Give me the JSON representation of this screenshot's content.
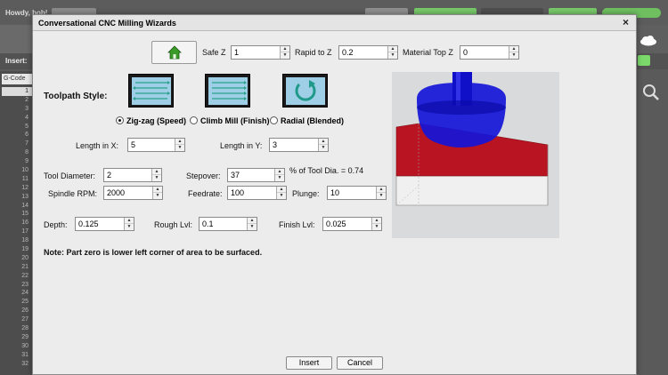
{
  "background": {
    "howdy": "Howdy, bob!",
    "insert_label": "Insert:",
    "gcode_tab": "G-Code",
    "line_numbers": [
      "1",
      "2",
      "3",
      "4",
      "5",
      "6",
      "7",
      "8",
      "9",
      "10",
      "11",
      "12",
      "13",
      "14",
      "15",
      "16",
      "17",
      "18",
      "19",
      "20",
      "21",
      "22",
      "23",
      "24",
      "25",
      "26",
      "27",
      "28",
      "29",
      "30",
      "31",
      "32"
    ]
  },
  "dialog": {
    "title": "Conversational CNC Milling Wizards",
    "close": "×",
    "top_row": {
      "safe_z_label": "Safe Z",
      "safe_z_value": "1",
      "rapid_to_z_label": "Rapid to Z",
      "rapid_to_z_value": "0.2",
      "material_top_z_label": "Material Top Z",
      "material_top_z_value": "0"
    },
    "toolpath_style_label": "Toolpath Style:",
    "toolpath_options": [
      {
        "label": "Zig-zag (Speed)",
        "selected": true
      },
      {
        "label": "Climb Mill (Finish)",
        "selected": false
      },
      {
        "label": "Radial (Blended)",
        "selected": false
      }
    ],
    "length_x_label": "Length in X:",
    "length_x_value": "5",
    "length_y_label": "Length in Y:",
    "length_y_value": "3",
    "tool_diameter_label": "Tool Diameter:",
    "tool_diameter_value": "2",
    "stepover_label": "Stepover:",
    "stepover_value": "37",
    "stepover_note": "% of Tool Dia. = 0.74",
    "spindle_rpm_label": "Spindle RPM:",
    "spindle_rpm_value": "2000",
    "feedrate_label": "Feedrate:",
    "feedrate_value": "100",
    "plunge_label": "Plunge:",
    "plunge_value": "10",
    "depth_label": "Depth:",
    "depth_value": "0.125",
    "rough_lvl_label": "Rough Lvl:",
    "rough_lvl_value": "0.1",
    "finish_lvl_label": "Finish Lvl:",
    "finish_lvl_value": "0.025",
    "note": "Note:  Part zero is lower left corner of area to be surfaced.",
    "insert_button": "Insert",
    "cancel_button": "Cancel"
  },
  "colors": {
    "tool_blue": "#1010d8",
    "stock_top_red": "#b81422",
    "home_green": "#3a9a2a",
    "radial_arrow": "#1f9a8a",
    "zigzag_lines": "#2aa08a"
  }
}
